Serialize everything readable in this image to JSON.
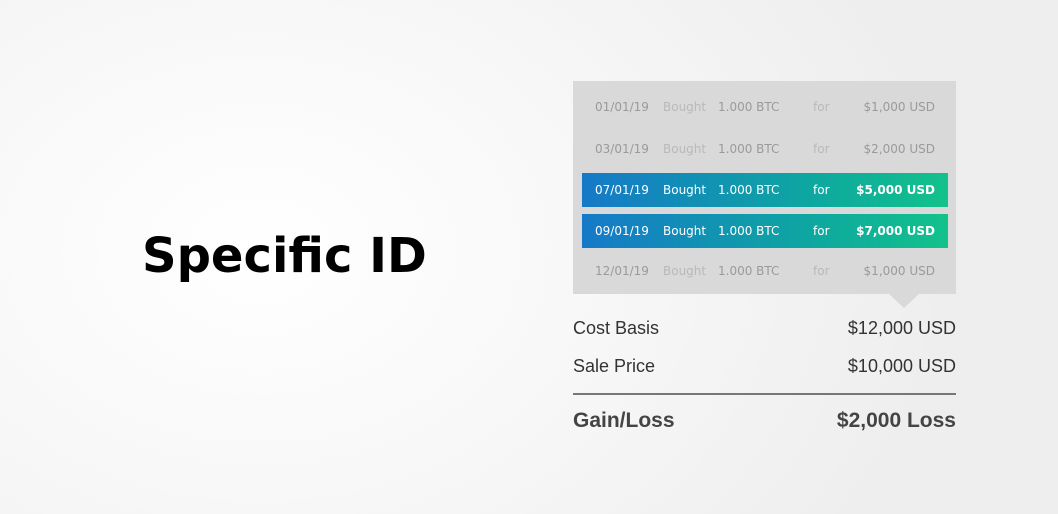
{
  "title": "Specific ID",
  "transactions": [
    {
      "date": "01/01/19",
      "action": "Bought",
      "quantity": "1.000 BTC",
      "for": "for",
      "amount": "$1,000 USD",
      "selected": false
    },
    {
      "date": "03/01/19",
      "action": "Bought",
      "quantity": "1.000 BTC",
      "for": "for",
      "amount": "$2,000 USD",
      "selected": false
    },
    {
      "date": "07/01/19",
      "action": "Bought",
      "quantity": "1.000 BTC",
      "for": "for",
      "amount": "$5,000 USD",
      "selected": true
    },
    {
      "date": "09/01/19",
      "action": "Bought",
      "quantity": "1.000 BTC",
      "for": "for",
      "amount": "$7,000 USD",
      "selected": true
    },
    {
      "date": "12/01/19",
      "action": "Bought",
      "quantity": "1.000 BTC",
      "for": "for",
      "amount": "$1,000 USD",
      "selected": false
    }
  ],
  "summary": {
    "cost_basis_label": "Cost Basis",
    "cost_basis_value": "$12,000 USD",
    "sale_price_label": "Sale Price",
    "sale_price_value": "$10,000 USD",
    "gain_loss_label": "Gain/Loss",
    "gain_loss_value": "$2,000 Loss"
  },
  "colors": {
    "selected_gradient_start": "#1679c8",
    "selected_gradient_end": "#12c28a",
    "panel_background": "#d9d9d9"
  }
}
